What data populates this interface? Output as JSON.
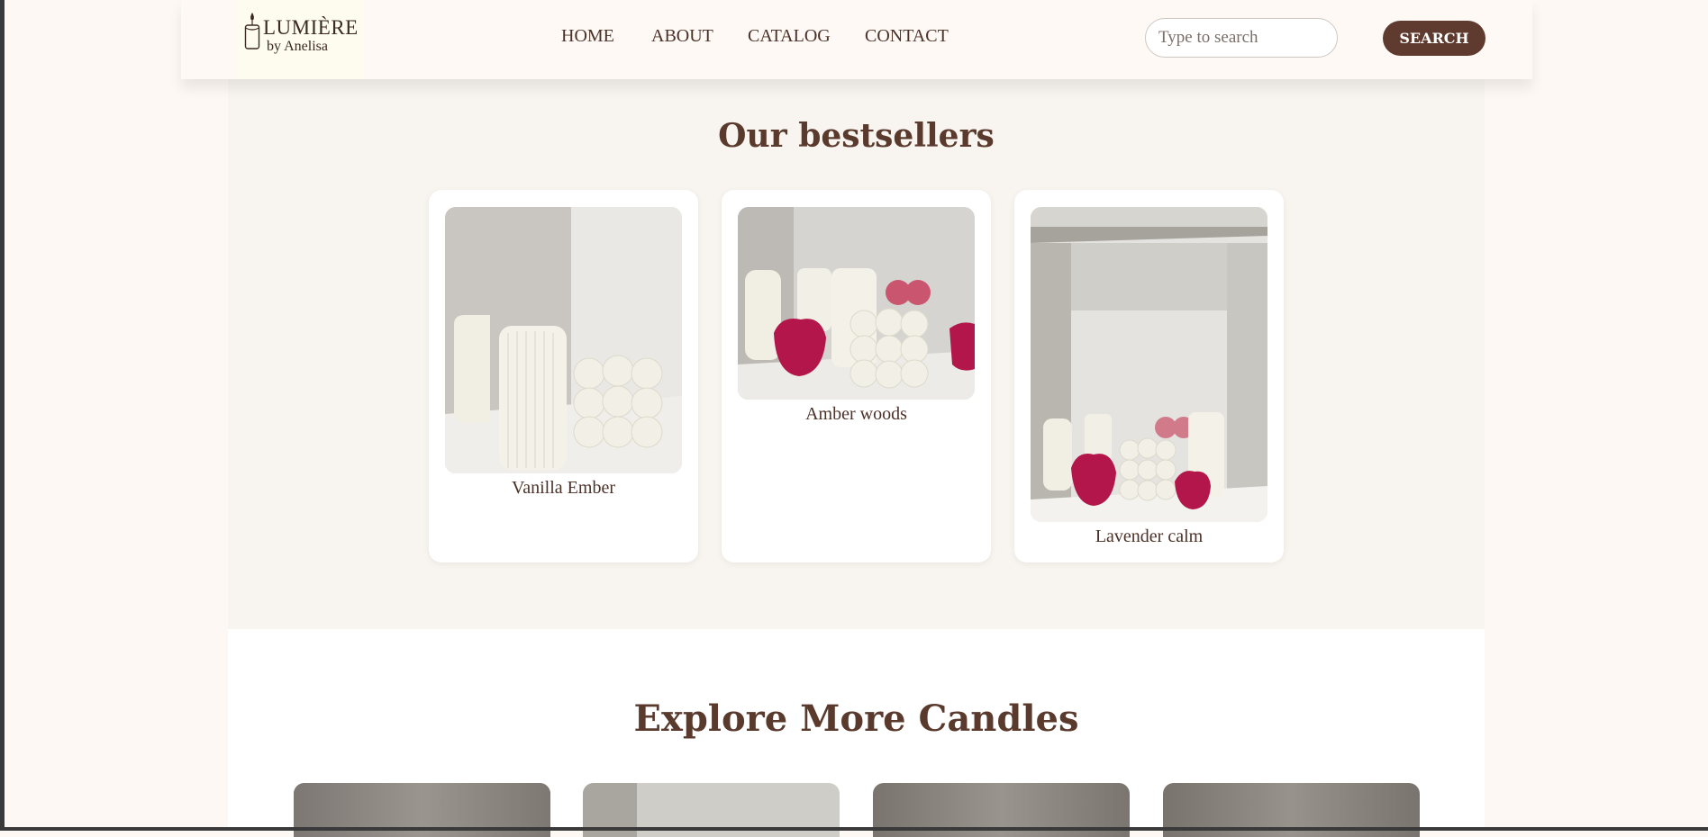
{
  "brand": {
    "title": "LUMIÈRE",
    "subtitle": "by Anelisa",
    "icon": "candle-icon"
  },
  "nav": {
    "items": [
      "HOME",
      "ABOUT",
      "CATALOG",
      "CONTACT"
    ]
  },
  "search": {
    "placeholder": "Type to search",
    "button_label": "SEARCH"
  },
  "bestsellers": {
    "title": "Our bestsellers",
    "products": [
      {
        "name": "Vanilla Ember"
      },
      {
        "name": "Amber woods"
      },
      {
        "name": "Lavender calm"
      }
    ]
  },
  "explore": {
    "title": "Explore More Candles",
    "thumbnail_count": 4
  },
  "colors": {
    "accent": "#5e3b2e",
    "heading": "#5b3a2e",
    "page_bg": "#fdf8f4",
    "section_bg": "#f8f4ef"
  }
}
